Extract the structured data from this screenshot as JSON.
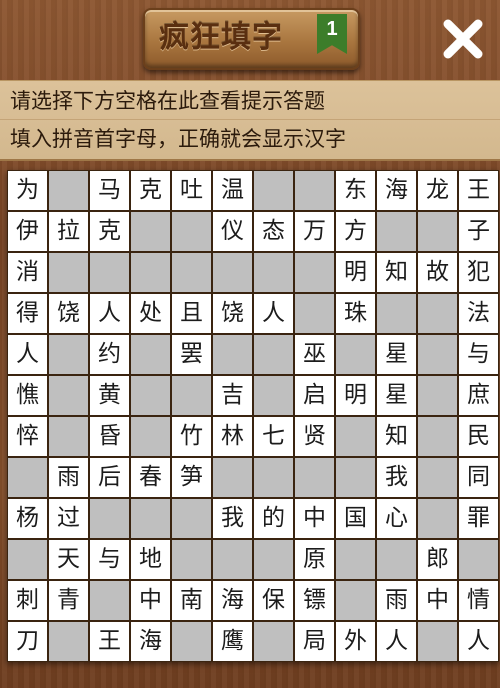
{
  "header": {
    "title": "疯狂填字",
    "level": "1",
    "close_icon": "close-icon"
  },
  "hints": {
    "line1": "请选择下方空格在此查看提示答题",
    "line2": "填入拼音首字母，正确就会显示汉字"
  },
  "colors": {
    "cell_white": "#ffffff",
    "cell_gray": "#bfbfbf",
    "grid_line": "#3a2410",
    "hint_bg": "#d8bd93",
    "badge_green": "#3c7d2a"
  },
  "grid": {
    "rows": [
      [
        "为",
        "",
        "马",
        "克",
        "吐",
        "温",
        "",
        "",
        "东",
        "海",
        "龙",
        "王"
      ],
      [
        "伊",
        "拉",
        "克",
        "",
        "",
        "仪",
        "态",
        "万",
        "方",
        "",
        "",
        "子"
      ],
      [
        "消",
        "",
        "",
        "",
        "",
        "",
        "",
        "",
        "明",
        "知",
        "故",
        "犯"
      ],
      [
        "得",
        "饶",
        "人",
        "处",
        "且",
        "饶",
        "人",
        "",
        "珠",
        "",
        "",
        "法"
      ],
      [
        "人",
        "",
        "约",
        "",
        "罢",
        "",
        "",
        "巫",
        "",
        "星",
        "",
        "与"
      ],
      [
        "憔",
        "",
        "黄",
        "",
        "",
        "吉",
        "",
        "启",
        "明",
        "星",
        "",
        "庶"
      ],
      [
        "悴",
        "",
        "昏",
        "",
        "竹",
        "林",
        "七",
        "贤",
        "",
        "知",
        "",
        "民"
      ],
      [
        "",
        "雨",
        "后",
        "春",
        "笋",
        "",
        "",
        "",
        "",
        "我",
        "",
        "同"
      ],
      [
        "杨",
        "过",
        "",
        "",
        "",
        "我",
        "的",
        "中",
        "国",
        "心",
        "",
        "罪"
      ],
      [
        "",
        "天",
        "与",
        "地",
        "",
        "",
        "",
        "原",
        "",
        "",
        "郎",
        ""
      ],
      [
        "刺",
        "青",
        "",
        "中",
        "南",
        "海",
        "保",
        "镖",
        "",
        "雨",
        "中",
        "情"
      ],
      [
        "刀",
        "",
        "王",
        "海",
        "",
        "鹰",
        "",
        "局",
        "外",
        "人",
        "",
        "人"
      ]
    ],
    "white_mask": [
      [
        1,
        0,
        1,
        1,
        1,
        1,
        0,
        0,
        1,
        1,
        1,
        1
      ],
      [
        1,
        1,
        1,
        0,
        0,
        1,
        1,
        1,
        1,
        0,
        0,
        1
      ],
      [
        1,
        0,
        0,
        0,
        0,
        0,
        0,
        0,
        1,
        1,
        1,
        1
      ],
      [
        1,
        1,
        1,
        1,
        1,
        1,
        1,
        0,
        1,
        0,
        0,
        1
      ],
      [
        1,
        0,
        1,
        0,
        1,
        0,
        0,
        1,
        0,
        1,
        0,
        1
      ],
      [
        1,
        0,
        1,
        0,
        0,
        1,
        0,
        1,
        1,
        1,
        0,
        1
      ],
      [
        1,
        0,
        1,
        0,
        1,
        1,
        1,
        1,
        0,
        1,
        0,
        1
      ],
      [
        0,
        1,
        1,
        1,
        1,
        0,
        0,
        0,
        0,
        1,
        0,
        1
      ],
      [
        1,
        1,
        0,
        0,
        0,
        1,
        1,
        1,
        1,
        1,
        0,
        1
      ],
      [
        0,
        1,
        1,
        1,
        0,
        0,
        0,
        1,
        0,
        0,
        1,
        0
      ],
      [
        1,
        1,
        0,
        1,
        1,
        1,
        1,
        1,
        0,
        1,
        1,
        1
      ],
      [
        1,
        0,
        1,
        1,
        0,
        1,
        0,
        1,
        1,
        1,
        0,
        1
      ]
    ]
  }
}
